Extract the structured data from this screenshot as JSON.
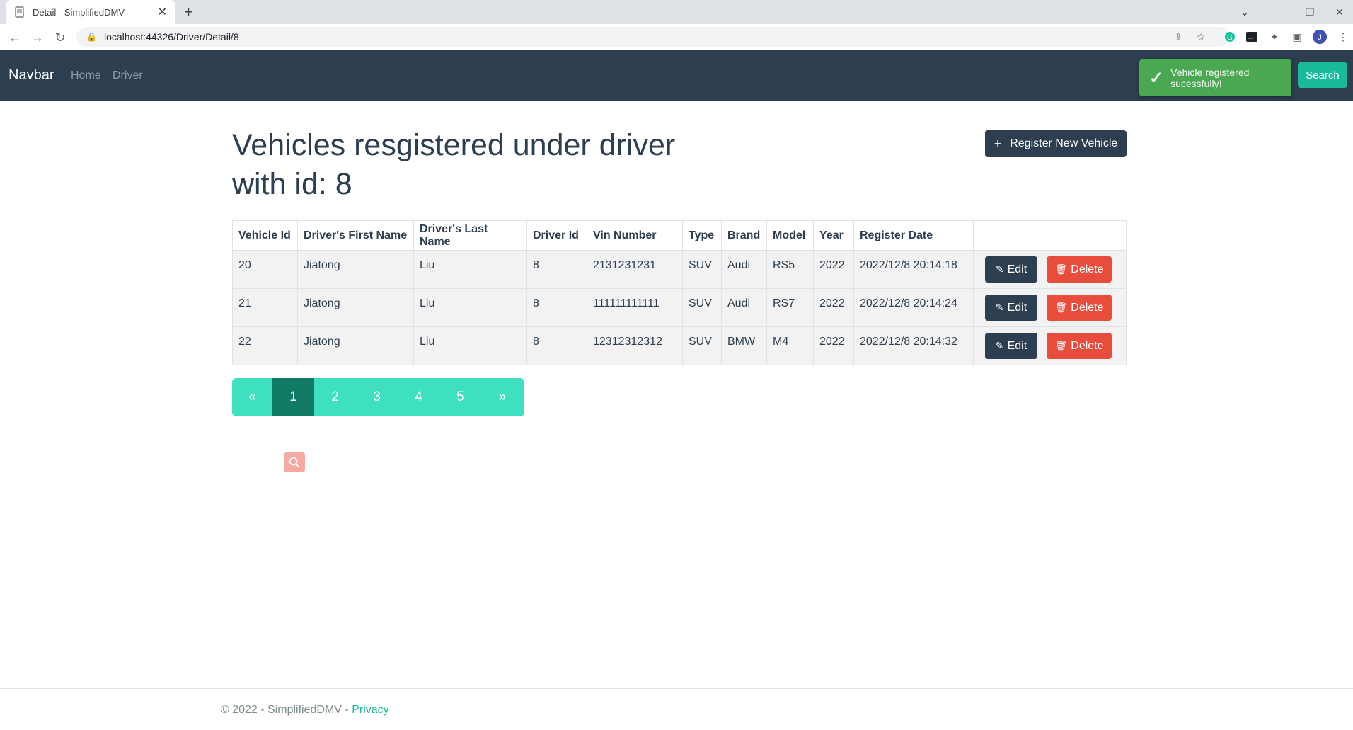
{
  "browser": {
    "tab_title": "Detail - SimplifiedDMV",
    "url": "localhost:44326/Driver/Detail/8",
    "profile_initial": "J"
  },
  "navbar": {
    "brand": "Navbar",
    "links": [
      "Home",
      "Driver"
    ],
    "search_label": "Search"
  },
  "toast": {
    "message": "Vehicle registered sucessfully!"
  },
  "page": {
    "title_line1": "Vehicles resgistered under driver",
    "title_line2": "with id: 8",
    "register_button": "Register New Vehicle"
  },
  "table": {
    "headers": [
      "Vehicle Id",
      "Driver's First Name",
      "Driver's Last Name",
      "Driver Id",
      "Vin Number",
      "Type",
      "Brand",
      "Model",
      "Year",
      "Register Date"
    ],
    "rows": [
      [
        "20",
        "Jiatong",
        "Liu",
        "8",
        "2131231231",
        "SUV",
        "Audi",
        "RS5",
        "2022",
        "2022/12/8 20:14:18"
      ],
      [
        "21",
        "Jiatong",
        "Liu",
        "8",
        "111111111111",
        "SUV",
        "Audi",
        "RS7",
        "2022",
        "2022/12/8 20:14:24"
      ],
      [
        "22",
        "Jiatong",
        "Liu",
        "8",
        "12312312312",
        "SUV",
        "BMW",
        "M4",
        "2022",
        "2022/12/8 20:14:32"
      ]
    ],
    "edit_label": "Edit",
    "delete_label": "Delete"
  },
  "pagination": {
    "prev": "«",
    "pages": [
      "1",
      "2",
      "3",
      "4",
      "5"
    ],
    "next": "»",
    "active": "1"
  },
  "footer": {
    "copyright": "© 2022 - SimplifiedDMV - ",
    "privacy": "Privacy"
  },
  "colors": {
    "primary": "#2c3e50",
    "success": "#18bc9c",
    "danger": "#e74c3c",
    "toast": "#4caf50"
  }
}
